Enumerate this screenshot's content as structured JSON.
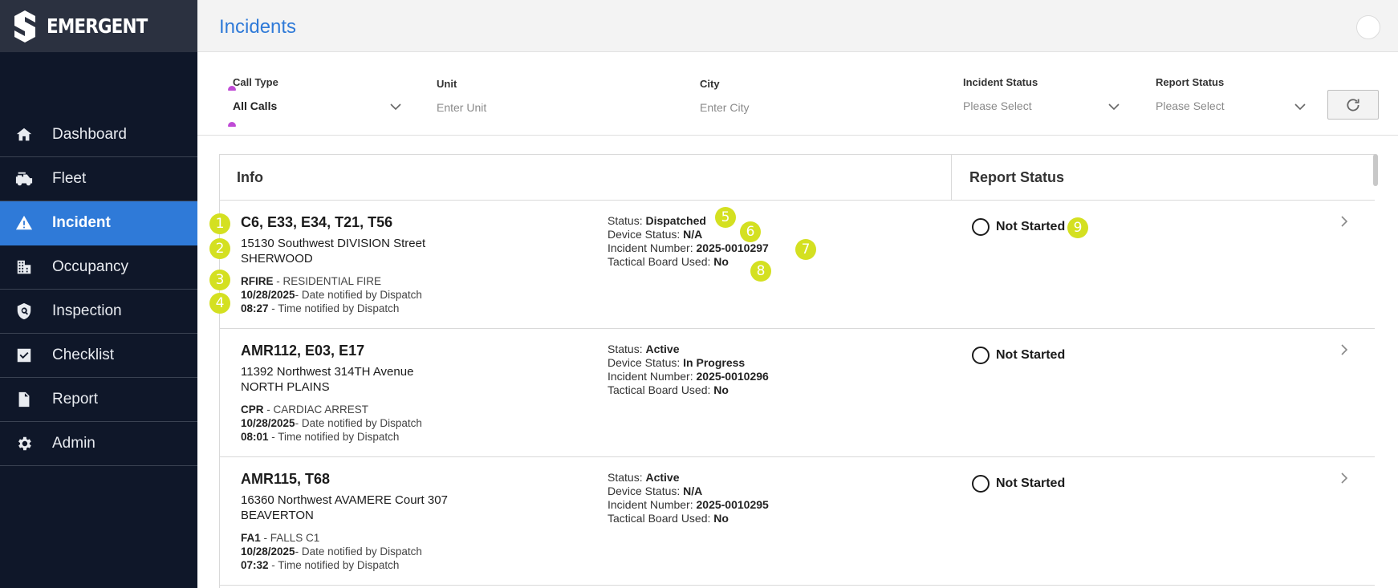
{
  "brand": {
    "name": "EMERGENT"
  },
  "sidebar": {
    "items": [
      {
        "label": "Dashboard",
        "icon": "home-icon"
      },
      {
        "label": "Fleet",
        "icon": "fire-truck-icon"
      },
      {
        "label": "Incident",
        "icon": "warning-icon",
        "active": true
      },
      {
        "label": "Occupancy",
        "icon": "building-icon"
      },
      {
        "label": "Inspection",
        "icon": "shield-icon"
      },
      {
        "label": "Checklist",
        "icon": "checkbox-icon"
      },
      {
        "label": "Report",
        "icon": "document-icon"
      },
      {
        "label": "Admin",
        "icon": "gear-icon"
      }
    ]
  },
  "header": {
    "title": "Incidents"
  },
  "filters": {
    "call_type": {
      "label": "Call Type",
      "value": "All Calls"
    },
    "unit": {
      "label": "Unit",
      "placeholder": "Enter Unit"
    },
    "city": {
      "label": "City",
      "placeholder": "Enter City"
    },
    "incident_status": {
      "label": "Incident Status",
      "value": "Please Select"
    },
    "report_status": {
      "label": "Report Status",
      "value": "Please Select"
    }
  },
  "table": {
    "columns": [
      "Info",
      "Report Status"
    ],
    "rows": [
      {
        "units": "C6, E33, E34, T21, T56",
        "address_line1": "15130 Southwest DIVISION Street",
        "address_line2": "SHERWOOD",
        "call_code": "RFIRE",
        "call_desc": " - RESIDENTIAL FIRE",
        "date": "10/28/2025",
        "date_label": "- Date notified by Dispatch",
        "time": "08:27",
        "time_label": " - Time notified by Dispatch",
        "status_label": "Status: ",
        "status": "Dispatched",
        "device_label": "Device Status: ",
        "device_status": "N/A",
        "incident_label": "Incident Number: ",
        "incident_number": "2025-0010297",
        "tactical_label": "Tactical Board Used: ",
        "tactical": "No",
        "report_status": "Not Started"
      },
      {
        "units": "AMR112, E03, E17",
        "address_line1": "11392 Northwest 314TH Avenue",
        "address_line2": "NORTH PLAINS",
        "call_code": "CPR",
        "call_desc": " - CARDIAC ARREST",
        "date": "10/28/2025",
        "date_label": "- Date notified by Dispatch",
        "time": "08:01",
        "time_label": " - Time notified by Dispatch",
        "status_label": "Status: ",
        "status": "Active",
        "device_label": "Device Status: ",
        "device_status": "In Progress",
        "incident_label": "Incident Number: ",
        "incident_number": "2025-0010296",
        "tactical_label": "Tactical Board Used: ",
        "tactical": "No",
        "report_status": "Not Started"
      },
      {
        "units": "AMR115, T68",
        "address_line1": "16360 Northwest AVAMERE Court 307",
        "address_line2": "BEAVERTON",
        "call_code": "FA1",
        "call_desc": " - FALLS C1",
        "date": "10/28/2025",
        "date_label": "- Date notified by Dispatch",
        "time": "07:32",
        "time_label": " - Time notified by Dispatch",
        "status_label": "Status: ",
        "status": "Active",
        "device_label": "Device Status: ",
        "device_status": "N/A",
        "incident_label": "Incident Number: ",
        "incident_number": "2025-0010295",
        "tactical_label": "Tactical Board Used: ",
        "tactical": "No",
        "report_status": "Not Started"
      }
    ]
  },
  "markers": [
    "1",
    "2",
    "3",
    "4",
    "5",
    "6",
    "7",
    "8",
    "9"
  ],
  "colors": {
    "accent": "#2f7ad8",
    "sidebar": "#0f1729",
    "marker": "#d4e021"
  }
}
